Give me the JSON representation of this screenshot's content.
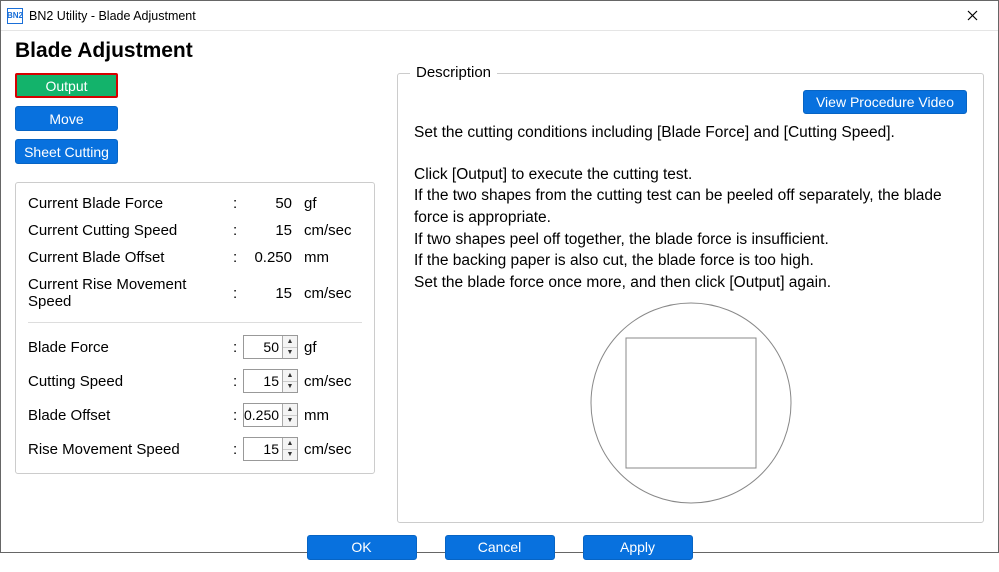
{
  "window": {
    "icon_text": "BN2",
    "title": "BN2 Utility - Blade Adjustment"
  },
  "page_title": "Blade Adjustment",
  "left_buttons": {
    "output": "Output",
    "move": "Move",
    "sheet_cutting": "Sheet Cutting"
  },
  "current": [
    {
      "label": "Current Blade Force",
      "value": "50",
      "unit": "gf"
    },
    {
      "label": "Current Cutting Speed",
      "value": "15",
      "unit": "cm/sec"
    },
    {
      "label": "Current Blade Offset",
      "value": "0.250",
      "unit": "mm"
    },
    {
      "label": "Current Rise Movement Speed",
      "value": "15",
      "unit": "cm/sec"
    }
  ],
  "settings": [
    {
      "label": "Blade Force",
      "value": "50",
      "unit": "gf"
    },
    {
      "label": "Cutting Speed",
      "value": "15",
      "unit": "cm/sec"
    },
    {
      "label": "Blade Offset",
      "value": "0.250",
      "unit": "mm"
    },
    {
      "label": "Rise Movement Speed",
      "value": "15",
      "unit": "cm/sec"
    }
  ],
  "description": {
    "heading": "Description",
    "video_button": "View Procedure Video",
    "lines": [
      "Set the cutting conditions including [Blade Force] and [Cutting Speed].",
      "Click [Output] to execute the cutting test.",
      "If the two shapes from the cutting test can be peeled off separately, the blade force is appropriate.",
      "If two shapes peel off together, the blade force is insufficient.",
      "If the backing paper is also cut, the blade force is too high.",
      "Set the blade force once more, and then click [Output] again."
    ]
  },
  "footer": {
    "ok": "OK",
    "cancel": "Cancel",
    "apply": "Apply"
  }
}
